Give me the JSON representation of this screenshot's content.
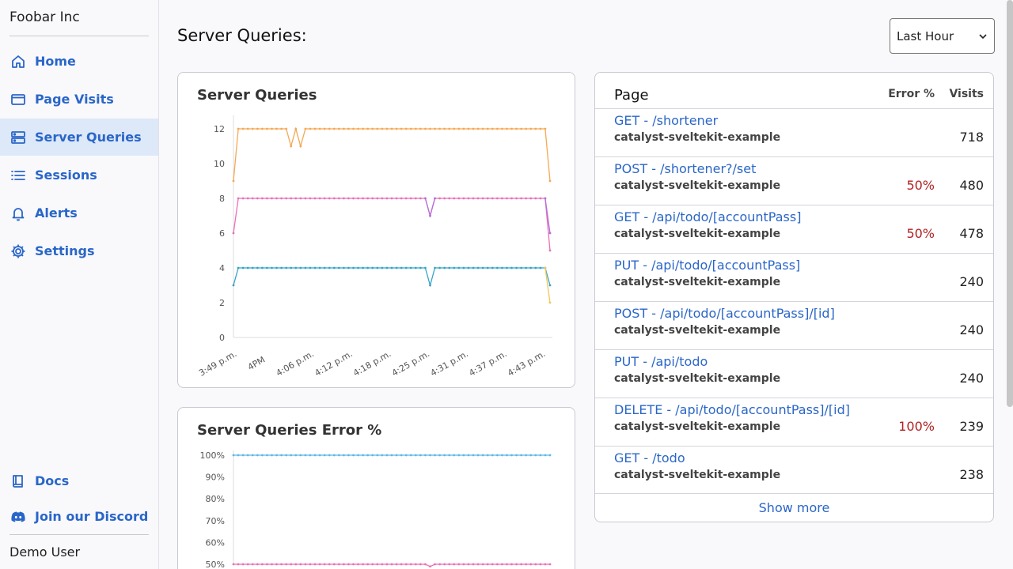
{
  "sidebar": {
    "brand": "Foobar Inc",
    "items": [
      {
        "label": "Home",
        "icon": "home-icon"
      },
      {
        "label": "Page Visits",
        "icon": "browser-window-icon"
      },
      {
        "label": "Server Queries",
        "icon": "server-icon"
      },
      {
        "label": "Sessions",
        "icon": "list-icon"
      },
      {
        "label": "Alerts",
        "icon": "bell-icon"
      },
      {
        "label": "Settings",
        "icon": "gear-icon"
      }
    ],
    "docs": "Docs",
    "discord": "Join our Discord",
    "user": "Demo User"
  },
  "header": {
    "title": "Server Queries:",
    "range": "Last Hour"
  },
  "colors": {
    "accent": "#2a66c8",
    "active_bg": "#dde8f8",
    "error_text": "#b22222",
    "series_orange": "#f5a855",
    "series_pink": "#ec6fb6",
    "series_teal": "#35a3c8",
    "series_yellow": "#f1c75a",
    "series_blue": "#5cb8e8"
  },
  "chart_data": [
    {
      "type": "line",
      "title": "Server Queries",
      "x_tick_labels": [
        "3:49 p.m.",
        "4PM",
        "4:06 p.m.",
        "4:12 p.m.",
        "4:18 p.m.",
        "4:25 p.m.",
        "4:31 p.m.",
        "4:37 p.m.",
        "4:43 p.m."
      ],
      "yticks": [
        0,
        2,
        4,
        6,
        8,
        10,
        12
      ],
      "ylim": [
        0,
        12.5
      ],
      "grid": false,
      "legend": "none",
      "series": [
        {
          "color": "#f5a855",
          "values": [
            9,
            12,
            12,
            12,
            12,
            12,
            12,
            12,
            12,
            12,
            12,
            12,
            11,
            12,
            11,
            12,
            12,
            12,
            12,
            12,
            12,
            12,
            12,
            12,
            12,
            12,
            12,
            12,
            12,
            12,
            12,
            12,
            12,
            12,
            12,
            12,
            12,
            12,
            12,
            12,
            12,
            12,
            12,
            12,
            12,
            12,
            12,
            12,
            12,
            12,
            12,
            12,
            12,
            12,
            12,
            12,
            12,
            12,
            12,
            12,
            12,
            12,
            12,
            12,
            12,
            12,
            9
          ]
        },
        {
          "color": "#ec6fb6",
          "values": [
            6,
            8,
            8,
            8,
            8,
            8,
            8,
            8,
            8,
            8,
            8,
            8,
            8,
            8,
            8,
            8,
            8,
            8,
            8,
            8,
            8,
            8,
            8,
            8,
            8,
            8,
            8,
            8,
            8,
            8,
            8,
            8,
            8,
            8,
            8,
            8,
            8,
            8,
            8,
            8,
            8,
            7,
            8,
            8,
            8,
            8,
            8,
            8,
            8,
            8,
            8,
            8,
            8,
            8,
            8,
            8,
            8,
            8,
            8,
            8,
            8,
            8,
            8,
            8,
            8,
            8,
            5
          ]
        },
        {
          "color": "#b36fd8",
          "values": [
            null,
            null,
            null,
            null,
            null,
            null,
            null,
            null,
            null,
            null,
            null,
            null,
            null,
            null,
            null,
            null,
            null,
            null,
            null,
            null,
            null,
            null,
            null,
            null,
            null,
            null,
            null,
            null,
            null,
            null,
            null,
            null,
            null,
            null,
            null,
            null,
            null,
            null,
            null,
            null,
            8,
            7,
            8,
            null,
            null,
            null,
            null,
            null,
            null,
            null,
            null,
            null,
            null,
            null,
            null,
            null,
            null,
            null,
            null,
            null,
            null,
            null,
            null,
            null,
            null,
            8,
            6
          ]
        },
        {
          "color": "#35a3c8",
          "values": [
            3,
            4,
            4,
            4,
            4,
            4,
            4,
            4,
            4,
            4,
            4,
            4,
            4,
            4,
            4,
            4,
            4,
            4,
            4,
            4,
            4,
            4,
            4,
            4,
            4,
            4,
            4,
            4,
            4,
            4,
            4,
            4,
            4,
            4,
            4,
            4,
            4,
            4,
            4,
            4,
            4,
            3,
            4,
            4,
            4,
            4,
            4,
            4,
            4,
            4,
            4,
            4,
            4,
            4,
            4,
            4,
            4,
            4,
            4,
            4,
            4,
            4,
            4,
            4,
            4,
            4,
            3
          ]
        },
        {
          "color": "#f1c75a",
          "values": [
            null,
            null,
            null,
            null,
            null,
            null,
            null,
            null,
            null,
            null,
            null,
            null,
            null,
            null,
            null,
            null,
            null,
            null,
            null,
            null,
            null,
            null,
            null,
            null,
            null,
            null,
            null,
            null,
            null,
            null,
            null,
            null,
            null,
            null,
            null,
            null,
            null,
            null,
            null,
            null,
            null,
            null,
            null,
            null,
            null,
            null,
            null,
            null,
            null,
            null,
            null,
            null,
            null,
            null,
            null,
            null,
            null,
            null,
            null,
            null,
            null,
            null,
            null,
            null,
            null,
            4,
            2
          ]
        }
      ]
    },
    {
      "type": "line",
      "title": "Server Queries Error %",
      "yticks": [
        "50%",
        "60%",
        "70%",
        "80%",
        "90%",
        "100%"
      ],
      "ylim": [
        50,
        100
      ],
      "grid": false,
      "legend": "none",
      "series": [
        {
          "color": "#5cb8e8",
          "values": [
            100,
            100,
            100,
            100,
            100,
            100,
            100,
            100,
            100,
            100,
            100,
            100,
            100,
            100,
            100,
            100,
            100,
            100,
            100,
            100,
            100,
            100,
            100,
            100,
            100,
            100,
            100,
            100,
            100,
            100,
            100,
            100,
            100,
            100,
            100,
            100,
            100,
            100,
            100,
            100,
            100,
            100,
            100,
            100,
            100,
            100,
            100,
            100,
            100,
            100,
            100,
            100,
            100,
            100,
            100,
            100,
            100,
            100,
            100,
            100,
            100,
            100,
            100,
            100,
            100,
            100,
            100
          ]
        },
        {
          "color": "#ec6fb6",
          "values": [
            50,
            50,
            50,
            50,
            50,
            50,
            50,
            50,
            50,
            50,
            50,
            50,
            50,
            50,
            50,
            50,
            50,
            50,
            50,
            50,
            50,
            50,
            50,
            50,
            50,
            50,
            50,
            50,
            50,
            50,
            50,
            50,
            50,
            50,
            50,
            50,
            50,
            50,
            50,
            50,
            50,
            49,
            50,
            50,
            50,
            50,
            50,
            50,
            50,
            50,
            50,
            50,
            50,
            50,
            50,
            50,
            50,
            50,
            50,
            50,
            50,
            50,
            50,
            50,
            50,
            50,
            50
          ]
        }
      ]
    }
  ],
  "table": {
    "col_page": "Page",
    "col_error": "Error %",
    "col_visits": "Visits",
    "rows": [
      {
        "page": "GET - /shortener",
        "project": "catalyst-sveltekit-example",
        "error": "",
        "visits": "718"
      },
      {
        "page": "POST - /shortener?/set",
        "project": "catalyst-sveltekit-example",
        "error": "50%",
        "visits": "480"
      },
      {
        "page": "GET - /api/todo/[accountPass]",
        "project": "catalyst-sveltekit-example",
        "error": "50%",
        "visits": "478"
      },
      {
        "page": "PUT - /api/todo/[accountPass]",
        "project": "catalyst-sveltekit-example",
        "error": "",
        "visits": "240"
      },
      {
        "page": "POST - /api/todo/[accountPass]/[id]",
        "project": "catalyst-sveltekit-example",
        "error": "",
        "visits": "240"
      },
      {
        "page": "PUT - /api/todo",
        "project": "catalyst-sveltekit-example",
        "error": "",
        "visits": "240"
      },
      {
        "page": "DELETE - /api/todo/[accountPass]/[id]",
        "project": "catalyst-sveltekit-example",
        "error": "100%",
        "visits": "239"
      },
      {
        "page": "GET - /todo",
        "project": "catalyst-sveltekit-example",
        "error": "",
        "visits": "238"
      }
    ],
    "show_more": "Show more"
  }
}
